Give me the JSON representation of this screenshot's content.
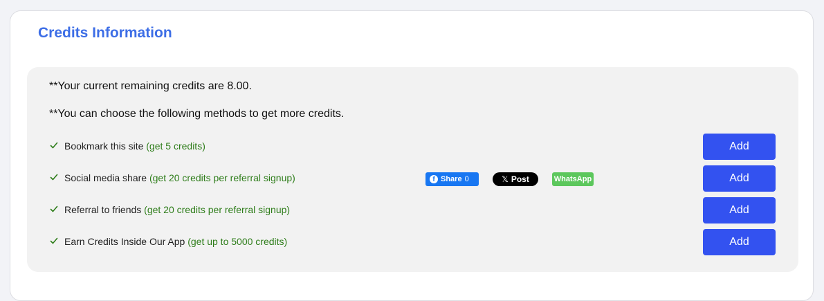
{
  "title": "Credits Information",
  "notes": {
    "remaining": "**Your current remaining credits are 8.00.",
    "methods": "**You can choose the following methods to get more credits."
  },
  "methods": [
    {
      "label": "Bookmark this site",
      "bonus": "(get 5 credits)",
      "button": "Add"
    },
    {
      "label": "Social media share",
      "bonus": "(get 20 credits per referral signup)",
      "button": "Add"
    },
    {
      "label": "Referral to friends",
      "bonus": "(get 20 credits per referral signup)",
      "button": "Add"
    },
    {
      "label": "Earn Credits Inside Our App",
      "bonus": "(get up to 5000 credits)",
      "button": "Add"
    }
  ],
  "share": {
    "facebook_label": "Share",
    "facebook_count": "0",
    "x_label": "Post",
    "whatsapp_label": "WhatsApp"
  },
  "colors": {
    "title": "#3d6ee6",
    "bonus": "#2e7d1a",
    "add_button": "#3352f0",
    "facebook": "#1877f2",
    "x": "#000000",
    "whatsapp": "#5cc75c"
  },
  "icons": {
    "check": "check-icon",
    "facebook": "facebook-icon",
    "x": "x-logo-icon"
  }
}
